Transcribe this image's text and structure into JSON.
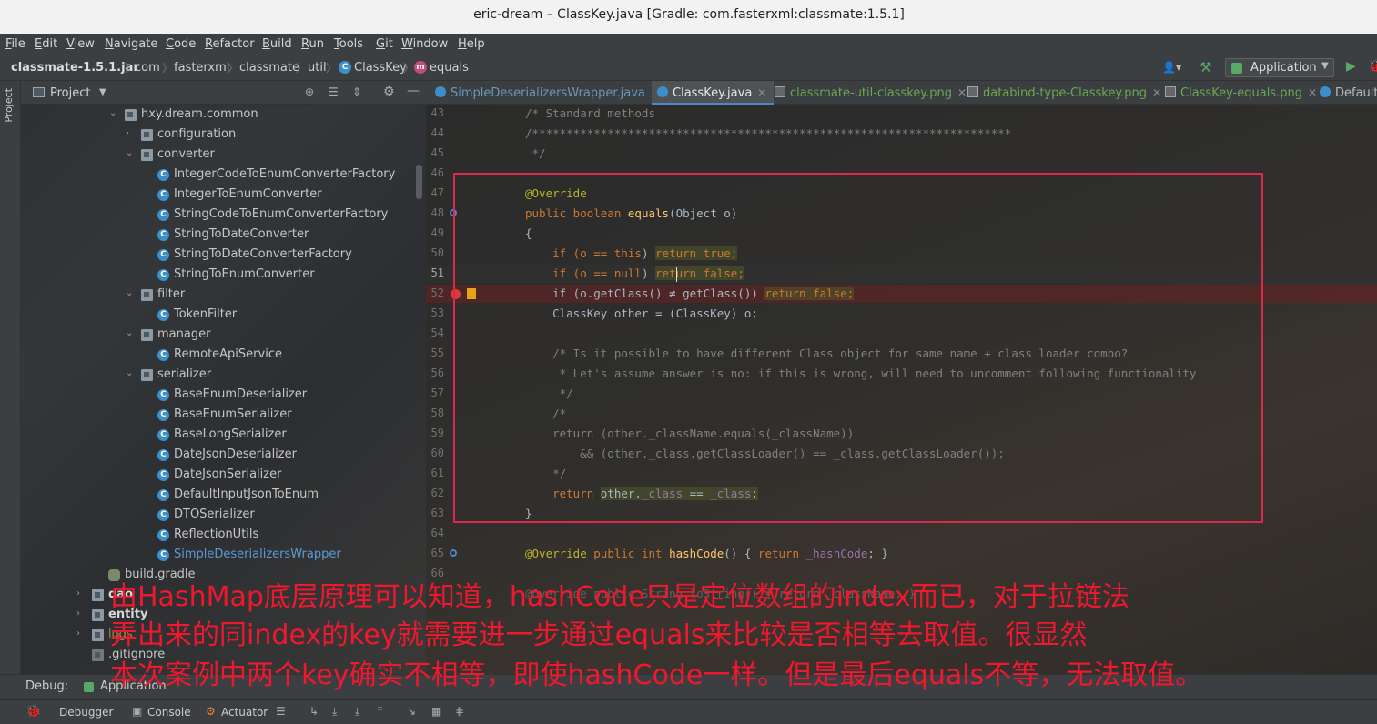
{
  "window": {
    "title": "eric-dream – ClassKey.java [Gradle: com.fasterxml:classmate:1.5.1]"
  },
  "menu": [
    "File",
    "Edit",
    "View",
    "Navigate",
    "Code",
    "Refactor",
    "Build",
    "Run",
    "Tools",
    "Git",
    "Window",
    "Help"
  ],
  "breadcrumb": {
    "jar": "classmate-1.5.1.jar",
    "p1": "com",
    "p2": "fasterxml",
    "p3": "classmate",
    "p4": "util",
    "cls": "ClassKey",
    "method": "equals"
  },
  "toolbar": {
    "run_config": "Application"
  },
  "project": {
    "strip_label": "Project",
    "header": "Project",
    "tree": [
      {
        "label": "hxy.dream.common",
        "kind": "folder",
        "expanded": true
      },
      {
        "label": "configuration",
        "kind": "folder",
        "expanded": false
      },
      {
        "label": "converter",
        "kind": "folder",
        "expanded": true
      },
      {
        "label": "IntegerCodeToEnumConverterFactory",
        "kind": "class"
      },
      {
        "label": "IntegerToEnumConverter",
        "kind": "class"
      },
      {
        "label": "StringCodeToEnumConverterFactory",
        "kind": "class"
      },
      {
        "label": "StringToDateConverter",
        "kind": "class"
      },
      {
        "label": "StringToDateConverterFactory",
        "kind": "class"
      },
      {
        "label": "StringToEnumConverter",
        "kind": "class"
      },
      {
        "label": "filter",
        "kind": "folder",
        "expanded": true
      },
      {
        "label": "TokenFilter",
        "kind": "class"
      },
      {
        "label": "manager",
        "kind": "folder",
        "expanded": true
      },
      {
        "label": "RemoteApiService",
        "kind": "class"
      },
      {
        "label": "serializer",
        "kind": "folder",
        "expanded": true
      },
      {
        "label": "BaseEnumDeserializer",
        "kind": "class"
      },
      {
        "label": "BaseEnumSerializer",
        "kind": "class"
      },
      {
        "label": "BaseLongSerializer",
        "kind": "class"
      },
      {
        "label": "DateJsonDeserializer",
        "kind": "class"
      },
      {
        "label": "DateJsonSerializer",
        "kind": "class"
      },
      {
        "label": "DefaultInputJsonToEnum",
        "kind": "class"
      },
      {
        "label": "DTOSerializer",
        "kind": "class"
      },
      {
        "label": "ReflectionUtils",
        "kind": "class"
      },
      {
        "label": "SimpleDeserializersWrapper",
        "kind": "class",
        "selected": true
      },
      {
        "label": "build.gradle",
        "kind": "gradle"
      },
      {
        "label": "dao",
        "kind": "folder",
        "expanded": false,
        "bold": true
      },
      {
        "label": "entity",
        "kind": "folder",
        "expanded": false,
        "bold": true
      },
      {
        "label": "logs",
        "kind": "folder",
        "expanded": false,
        "muted": true
      },
      {
        "label": ".gitignore",
        "kind": "file"
      }
    ]
  },
  "tabs": [
    {
      "label": "SimpleDeserializersWrapper.java",
      "icon": "cls",
      "active": false
    },
    {
      "label": "ClassKey.java",
      "icon": "cls",
      "active": true
    },
    {
      "label": "classmate-util-classkey.png",
      "icon": "png",
      "active": false
    },
    {
      "label": "databind-type-Classkey.png",
      "icon": "png",
      "active": false
    },
    {
      "label": "ClassKey-equals.png",
      "icon": "png",
      "active": false
    },
    {
      "label": "Default",
      "icon": "cls",
      "active": false
    }
  ],
  "code": {
    "line_numbers": [
      "43",
      "44",
      "45",
      "46",
      "47",
      "48",
      "49",
      "50",
      "51",
      "52",
      "53",
      "54",
      "55",
      "56",
      "57",
      "58",
      "59",
      "60",
      "61",
      "62",
      "63",
      "64",
      "65",
      "66",
      "69",
      "70"
    ],
    "l43": "/* Standard methods",
    "l44": "/**********************************************************************",
    "l45": " */",
    "l47": "@Override",
    "l48_kw": "public boolean ",
    "l48_fn": "equals",
    "l48_rest": "(Object o)",
    "l49": "{",
    "l50_a": "    if (o == ",
    "l50_b": "this",
    "l50_c": ") ",
    "l50_d": "return true;",
    "l51_a": "    if (o == ",
    "l51_b": "null",
    "l51_c": ") ",
    "l51_d": "return false;",
    "l52_a": "    if (o.getClass() ≠ getClass()) ",
    "l52_b": "return false;",
    "l53": "    ClassKey other = (ClassKey) o;",
    "l55": "    /* Is it possible to have different Class object for same name + class loader combo?",
    "l56": "     * Let's assume answer is no: if this is wrong, will need to uncomment following functionality",
    "l57": "     */",
    "l58": "    /*",
    "l59": "    return (other._className.equals(_className))",
    "l60": "        && (other._class.getClassLoader() == _class.getClassLoader());",
    "l61": "    */",
    "l62_a": "    return ",
    "l62_b": "other.",
    "l62_c": "_class",
    "l62_d": " == ",
    "l62_e": "_class",
    "l62_f": ";",
    "l63": "}",
    "l65_a": "@Override ",
    "l65_b": "public int ",
    "l65_c": "hashCode",
    "l65_d": "() { ",
    "l65_e": "return ",
    "l65_f": "_hashCode",
    "l65_g": "; }",
    "l67": "@Override public String toString() { return _className; }"
  },
  "annotation_text": [
    "由HashMap底层原理可以知道，hashCode只是定位数组的index而已，对于拉链法",
    "弄出来的同index的key就需要进一步通过equals来比较是否相等去取值。很显然",
    "本次案例中两个key确实不相等，即使hashCode一样。但是最后equals不等，无法取值。"
  ],
  "debug": {
    "label": "Debug:",
    "session": "Application"
  },
  "bottom_tabs": [
    "Debugger",
    "Console",
    "Actuator"
  ],
  "colors": {
    "annotation": "#f0182f",
    "highlight_box": "#e0264a",
    "accent": "#4a88c7"
  }
}
